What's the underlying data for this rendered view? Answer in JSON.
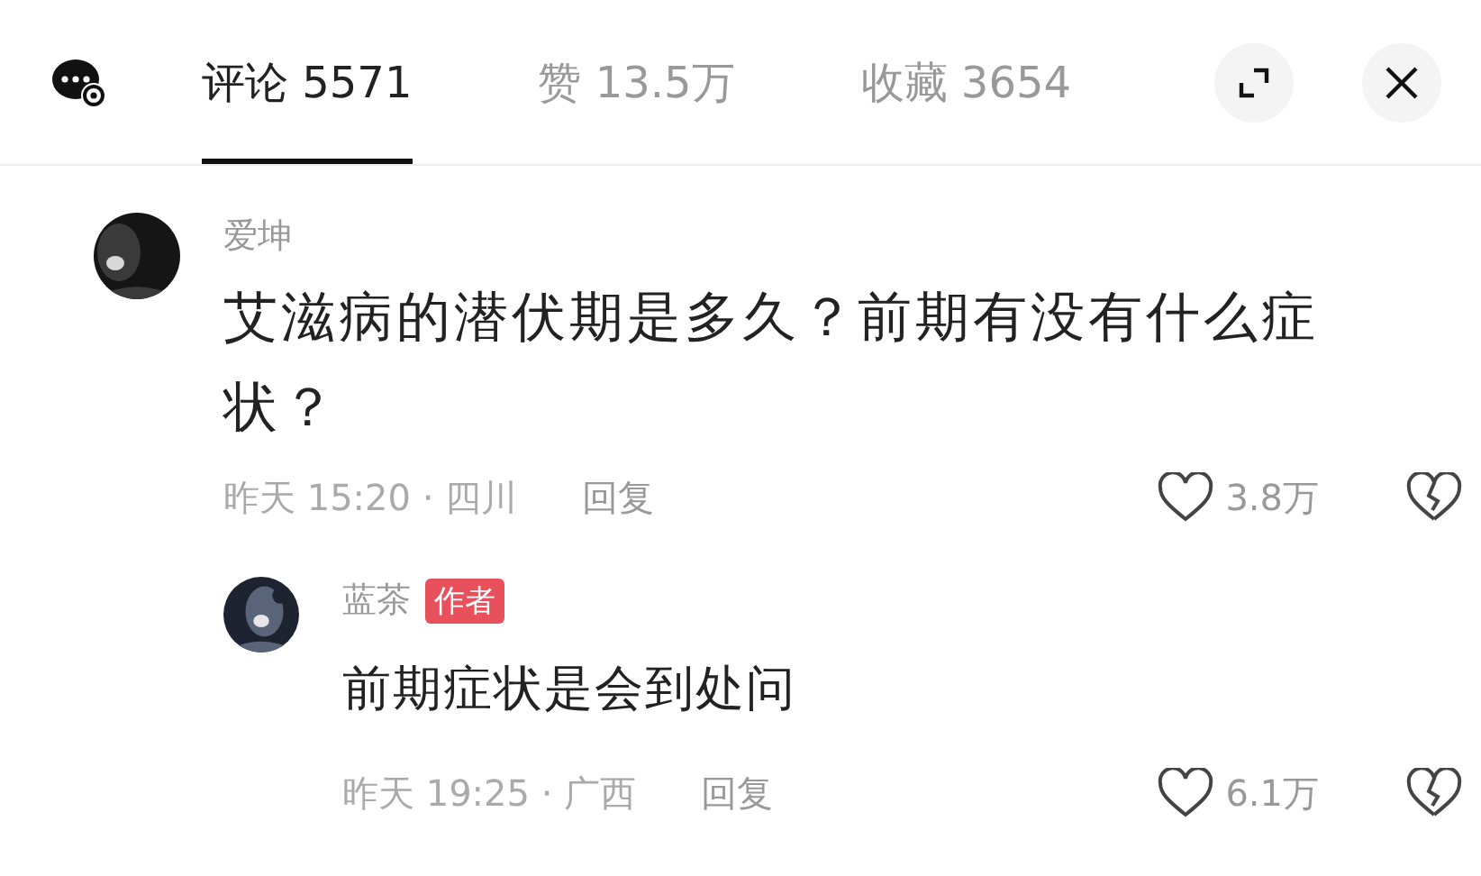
{
  "tabs": [
    {
      "label": "评论 5571",
      "selected": true
    },
    {
      "label": "赞 13.5万",
      "selected": false
    },
    {
      "label": "收藏 3654",
      "selected": false
    }
  ],
  "comments": [
    {
      "kind": "picture",
      "author": "爱坤",
      "text": "艾滋病的潜伏期是多久？前期有没有什么症状？",
      "time": "昨天 15:20 · 四川",
      "reply": "回复",
      "likes": "3.8万",
      "replies": [
        {
          "kind": "picture",
          "author": "蓝茶",
          "badge": "作者",
          "text": "前期症状是会到处问",
          "time": "昨天 19:25 · 广西",
          "reply": "回复",
          "likes": "6.1万"
        }
      ]
    }
  ]
}
